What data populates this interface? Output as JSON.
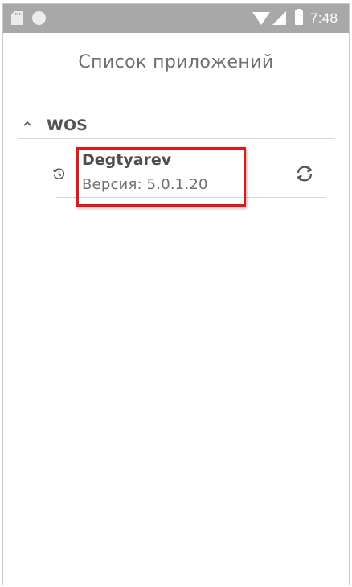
{
  "status_bar": {
    "time": "7:48",
    "icons": [
      "sd-card-icon",
      "circle-icon",
      "wifi-icon",
      "cell-signal-icon",
      "battery-icon"
    ],
    "background": "#a8a8a8"
  },
  "screen": {
    "title": "Список приложений"
  },
  "groups": [
    {
      "label": "WOS",
      "expanded": true,
      "icon": "chevron-up-icon",
      "apps": [
        {
          "name": "Degtyarev",
          "version": "Версия: 5.0.1.20",
          "leading_icon": "history-icon",
          "trailing_icon": "refresh-icon",
          "highlighted": true
        }
      ]
    }
  ],
  "colors": {
    "highlight": "#e01818",
    "divider": "#d9d9d9",
    "title_text": "#6e6e6e"
  }
}
